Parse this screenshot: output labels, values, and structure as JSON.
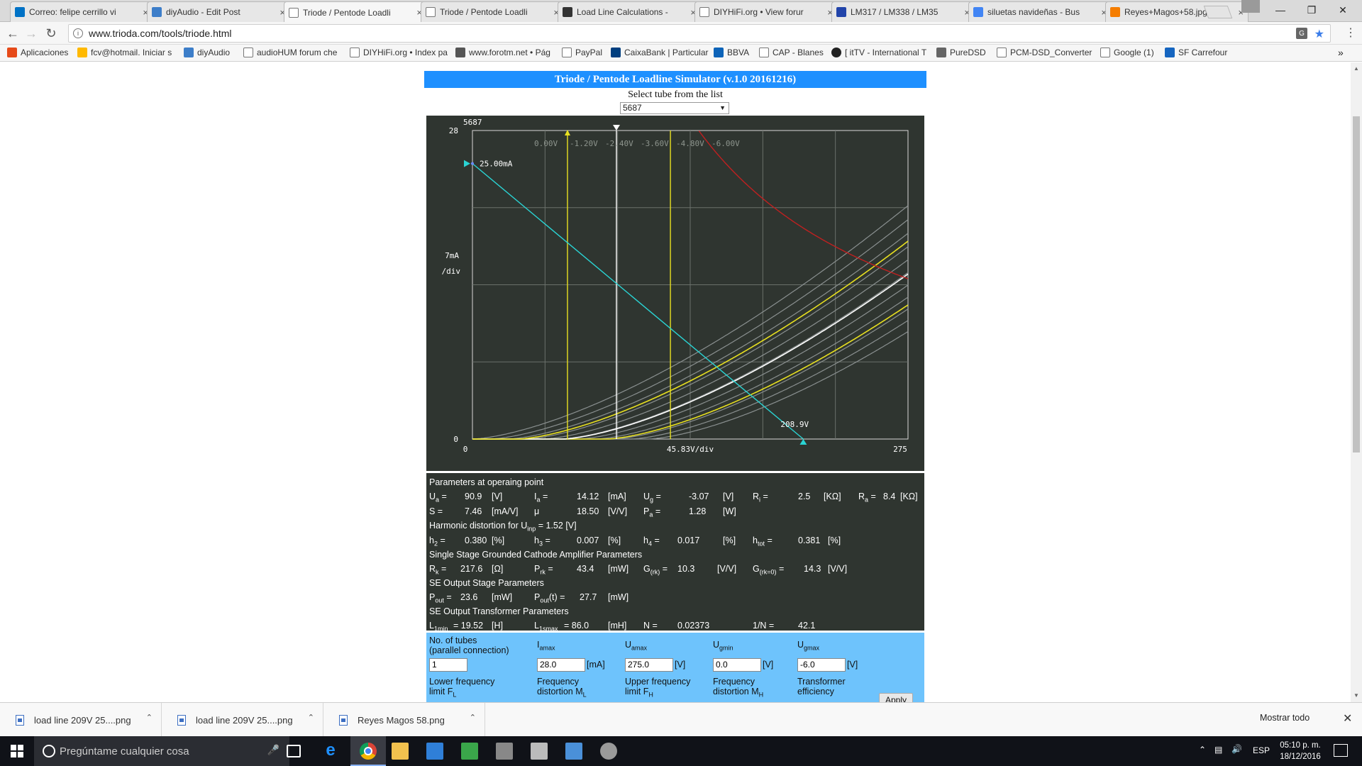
{
  "browser": {
    "tabs": [
      {
        "label": "Correo: felipe cerrillo vi",
        "favicon": "outlook-icon",
        "color": "#0072c6"
      },
      {
        "label": "diyAudio - Edit Post",
        "favicon": "diyaudio-icon",
        "color": "#3d7ec9"
      },
      {
        "label": "Triode / Pentode Loadli",
        "favicon": "page-icon",
        "color": "#ffffff",
        "active": true
      },
      {
        "label": "Triode / Pentode Loadli",
        "favicon": "page-icon",
        "color": "#ffffff"
      },
      {
        "label": "Load Line Calculations -",
        "favicon": "chart-icon",
        "color": "#333333"
      },
      {
        "label": "DIYHiFi.org • View forur",
        "favicon": "page-icon",
        "color": "#ffffff"
      },
      {
        "label": "LM317 / LM338 / LM35",
        "favicon": "diy-icon",
        "color": "#2244aa"
      },
      {
        "label": "siluetas navideñas - Bus",
        "favicon": "google-icon",
        "color": "#4285f4"
      },
      {
        "label": "Reyes+Magos+58.jpg (",
        "favicon": "blogger-icon",
        "color": "#f57d00"
      }
    ],
    "url": "www.trioda.com/tools/triode.html",
    "bookmarks": [
      {
        "label": "Aplicaciones",
        "icon": "apps-grid-icon"
      },
      {
        "label": "fcv@hotmail. Iniciar s",
        "icon": "msn-icon"
      },
      {
        "label": "diyAudio",
        "icon": "diyaudio-icon"
      },
      {
        "label": "audioHUM forum che",
        "icon": "page-icon"
      },
      {
        "label": "DIYHiFi.org • Index pa",
        "icon": "page-icon"
      },
      {
        "label": "www.forotm.net • Pág",
        "icon": "forotm-icon"
      },
      {
        "label": "PayPal",
        "icon": "page-icon"
      },
      {
        "label": "CaixaBank | Particular",
        "icon": "caixabank-icon"
      },
      {
        "label": "BBVA",
        "icon": "bbva-icon"
      },
      {
        "label": "CAP - Blanes",
        "icon": "page-icon"
      },
      {
        "label": "[ itTV - International T",
        "icon": "ittv-icon"
      },
      {
        "label": "PureDSD",
        "icon": "puredsd-icon"
      },
      {
        "label": "PCM-DSD_Converter",
        "icon": "page-icon"
      },
      {
        "label": "Google (1)",
        "icon": "page-icon"
      },
      {
        "label": "SF Carrefour",
        "icon": "carrefour-icon"
      }
    ],
    "bookmarks_more": "»"
  },
  "simulator": {
    "title": "Triode / Pentode Loadline Simulator (v.1.0 20161216)",
    "select_label": "Select tube from the list",
    "selected_tube": "5687",
    "graph": {
      "tube_label": "5687",
      "y_top_label": "28",
      "y_zero_label": "0",
      "y_div_label_1": "7mA",
      "y_div_label_2": "/div",
      "x_zero_label": "0",
      "x_div_label": "45.83V/div",
      "x_max_label": "275",
      "current_marker_label": "25.00mA",
      "voltage_marker_label": "208.9V",
      "grid_voltage_labels": [
        "0.00V",
        "-1.20V",
        "-2.40V",
        "-3.60V",
        "-4.80V",
        "-6.00V"
      ]
    },
    "params": {
      "op_title": "Parameters at operaing point",
      "ua_name": "U",
      "ua_sub": "a",
      "ua_val": "90.9",
      "ua_unit": "[V]",
      "ia_name": "I",
      "ia_sub": "a",
      "ia_val": "14.12",
      "ia_unit": "[mA]",
      "ug_name": "U",
      "ug_sub": "g",
      "ug_val": "-3.07",
      "ug_unit": "[V]",
      "ri_name": "R",
      "ri_sub": "i",
      "ri_val": "2.5",
      "ri_unit": "[KΩ]",
      "ra_name": "R",
      "ra_sub": "a",
      "ra_val": "8.4",
      "ra_unit": "[KΩ]",
      "s_name": "S =",
      "s_val": "7.46",
      "s_unit": "[mA/V]",
      "mu_name": "μ",
      "mu_val": "18.50",
      "mu_unit": "[V/V]",
      "pa_name": "P",
      "pa_sub": "a",
      "pa_val": "1.28",
      "pa_unit": "[W]",
      "hd_title_pre": "Harmonic distortion for U",
      "hd_title_sub": "inp",
      "hd_title_post": " = 1.52 [V]",
      "h2_name": "h",
      "h2_sub": "2",
      "h2_val": "0.380",
      "h2_unit": "[%]",
      "h3_name": "h",
      "h3_sub": "3",
      "h3_val": "0.007",
      "h3_unit": "[%]",
      "h4_name": "h",
      "h4_sub": "4",
      "h4_val": "0.017",
      "h4_unit": "[%]",
      "htot_name": "h",
      "htot_sub": "tot",
      "htot_val": "0.381",
      "htot_unit": "[%]",
      "ss_title": "Single Stage Grounded Cathode Amplifier Parameters",
      "rk_name": "R",
      "rk_sub": "k",
      "rk_val": "217.6",
      "rk_unit": "[Ω]",
      "prk_name": "P",
      "prk_sub": "rk",
      "prk_val": "43.4",
      "prk_unit": "[mW]",
      "grk_name": "G",
      "grk_sub": "(rk)",
      "grk_val": "10.3",
      "grk_unit": "[V/V]",
      "grk0_name": "G",
      "grk0_sub": "(rk=0)",
      "grk0_val": "14.3",
      "grk0_unit": "[V/V]",
      "se_title": "SE Output Stage Parameters",
      "pout_name": "P",
      "pout_sub": "out",
      "pout_val": "23.6",
      "pout_unit": "[mW]",
      "poutt_name": "P",
      "poutt_sub": "out",
      "poutt_suffix": "(t) =",
      "poutt_val": "27.7",
      "poutt_unit": "[mW]",
      "tr_title": "SE Output Transformer Parameters",
      "l1min_name": "L",
      "l1min_sub": "1min",
      "l1min_val": "= 19.52",
      "l1min_unit": "[H]",
      "l1smax_name": "L",
      "l1smax_sub": "1smax",
      "l1smax_val": "= 86.0",
      "l1smax_unit": "[mH]",
      "n_name": "N =",
      "n_val": "0.02373",
      "invn_name": "1/N =",
      "invn_val": "42.1"
    },
    "form": {
      "tubes_label_1": "No. of tubes",
      "tubes_label_2": "(parallel connection)",
      "tubes_value": "1",
      "iamax_name": "I",
      "iamax_sub": "amax",
      "iamax_value": "28.0",
      "iamax_unit": "[mA]",
      "uamax_name": "U",
      "uamax_sub": "amax",
      "uamax_value": "275.0",
      "uamax_unit": "[V]",
      "ugmin_name": "U",
      "ugmin_sub": "gmin",
      "ugmin_value": "0.0",
      "ugmin_unit": "[V]",
      "ugmax_name": "U",
      "ugmax_sub": "gmax",
      "ugmax_value": "-6.0",
      "ugmax_unit": "[V]",
      "lf_label_1": "Lower frequency",
      "lf_label_2": "limit F",
      "lf_sub": "L",
      "fd_label_1": "Frequency",
      "fd_label_2": "distortion M",
      "fd_sub": "L",
      "uf_label_1": "Upper frequency",
      "uf_label_2": "limit F",
      "uf_sub": "H",
      "fdh_label_1": "Frequency",
      "fdh_label_2": "distortion M",
      "fdh_sub": "H",
      "te_label_1": "Transformer",
      "te_label_2": "efficiency",
      "apply_label": "Apply"
    }
  },
  "downloads": {
    "items": [
      "load line 209V 25....png",
      "load line 209V 25....png",
      "Reyes Magos 58.png"
    ],
    "show_all": "Mostrar todo"
  },
  "taskbar": {
    "search_placeholder": "Pregúntame cualquier cosa",
    "lang": "ESP",
    "time": "05:10 p. m.",
    "date": "18/12/2016"
  },
  "colors": {
    "sim_title_bg": "#1e90ff",
    "panel_bg": "#2f3530",
    "form_bg": "#6ec3fc",
    "loadline": "#2ad4d4",
    "curve_yellow": "#e8e020",
    "curve_white": "#ffffff",
    "curve_gray": "#8a9090",
    "pmax_curve": "#c02020"
  }
}
